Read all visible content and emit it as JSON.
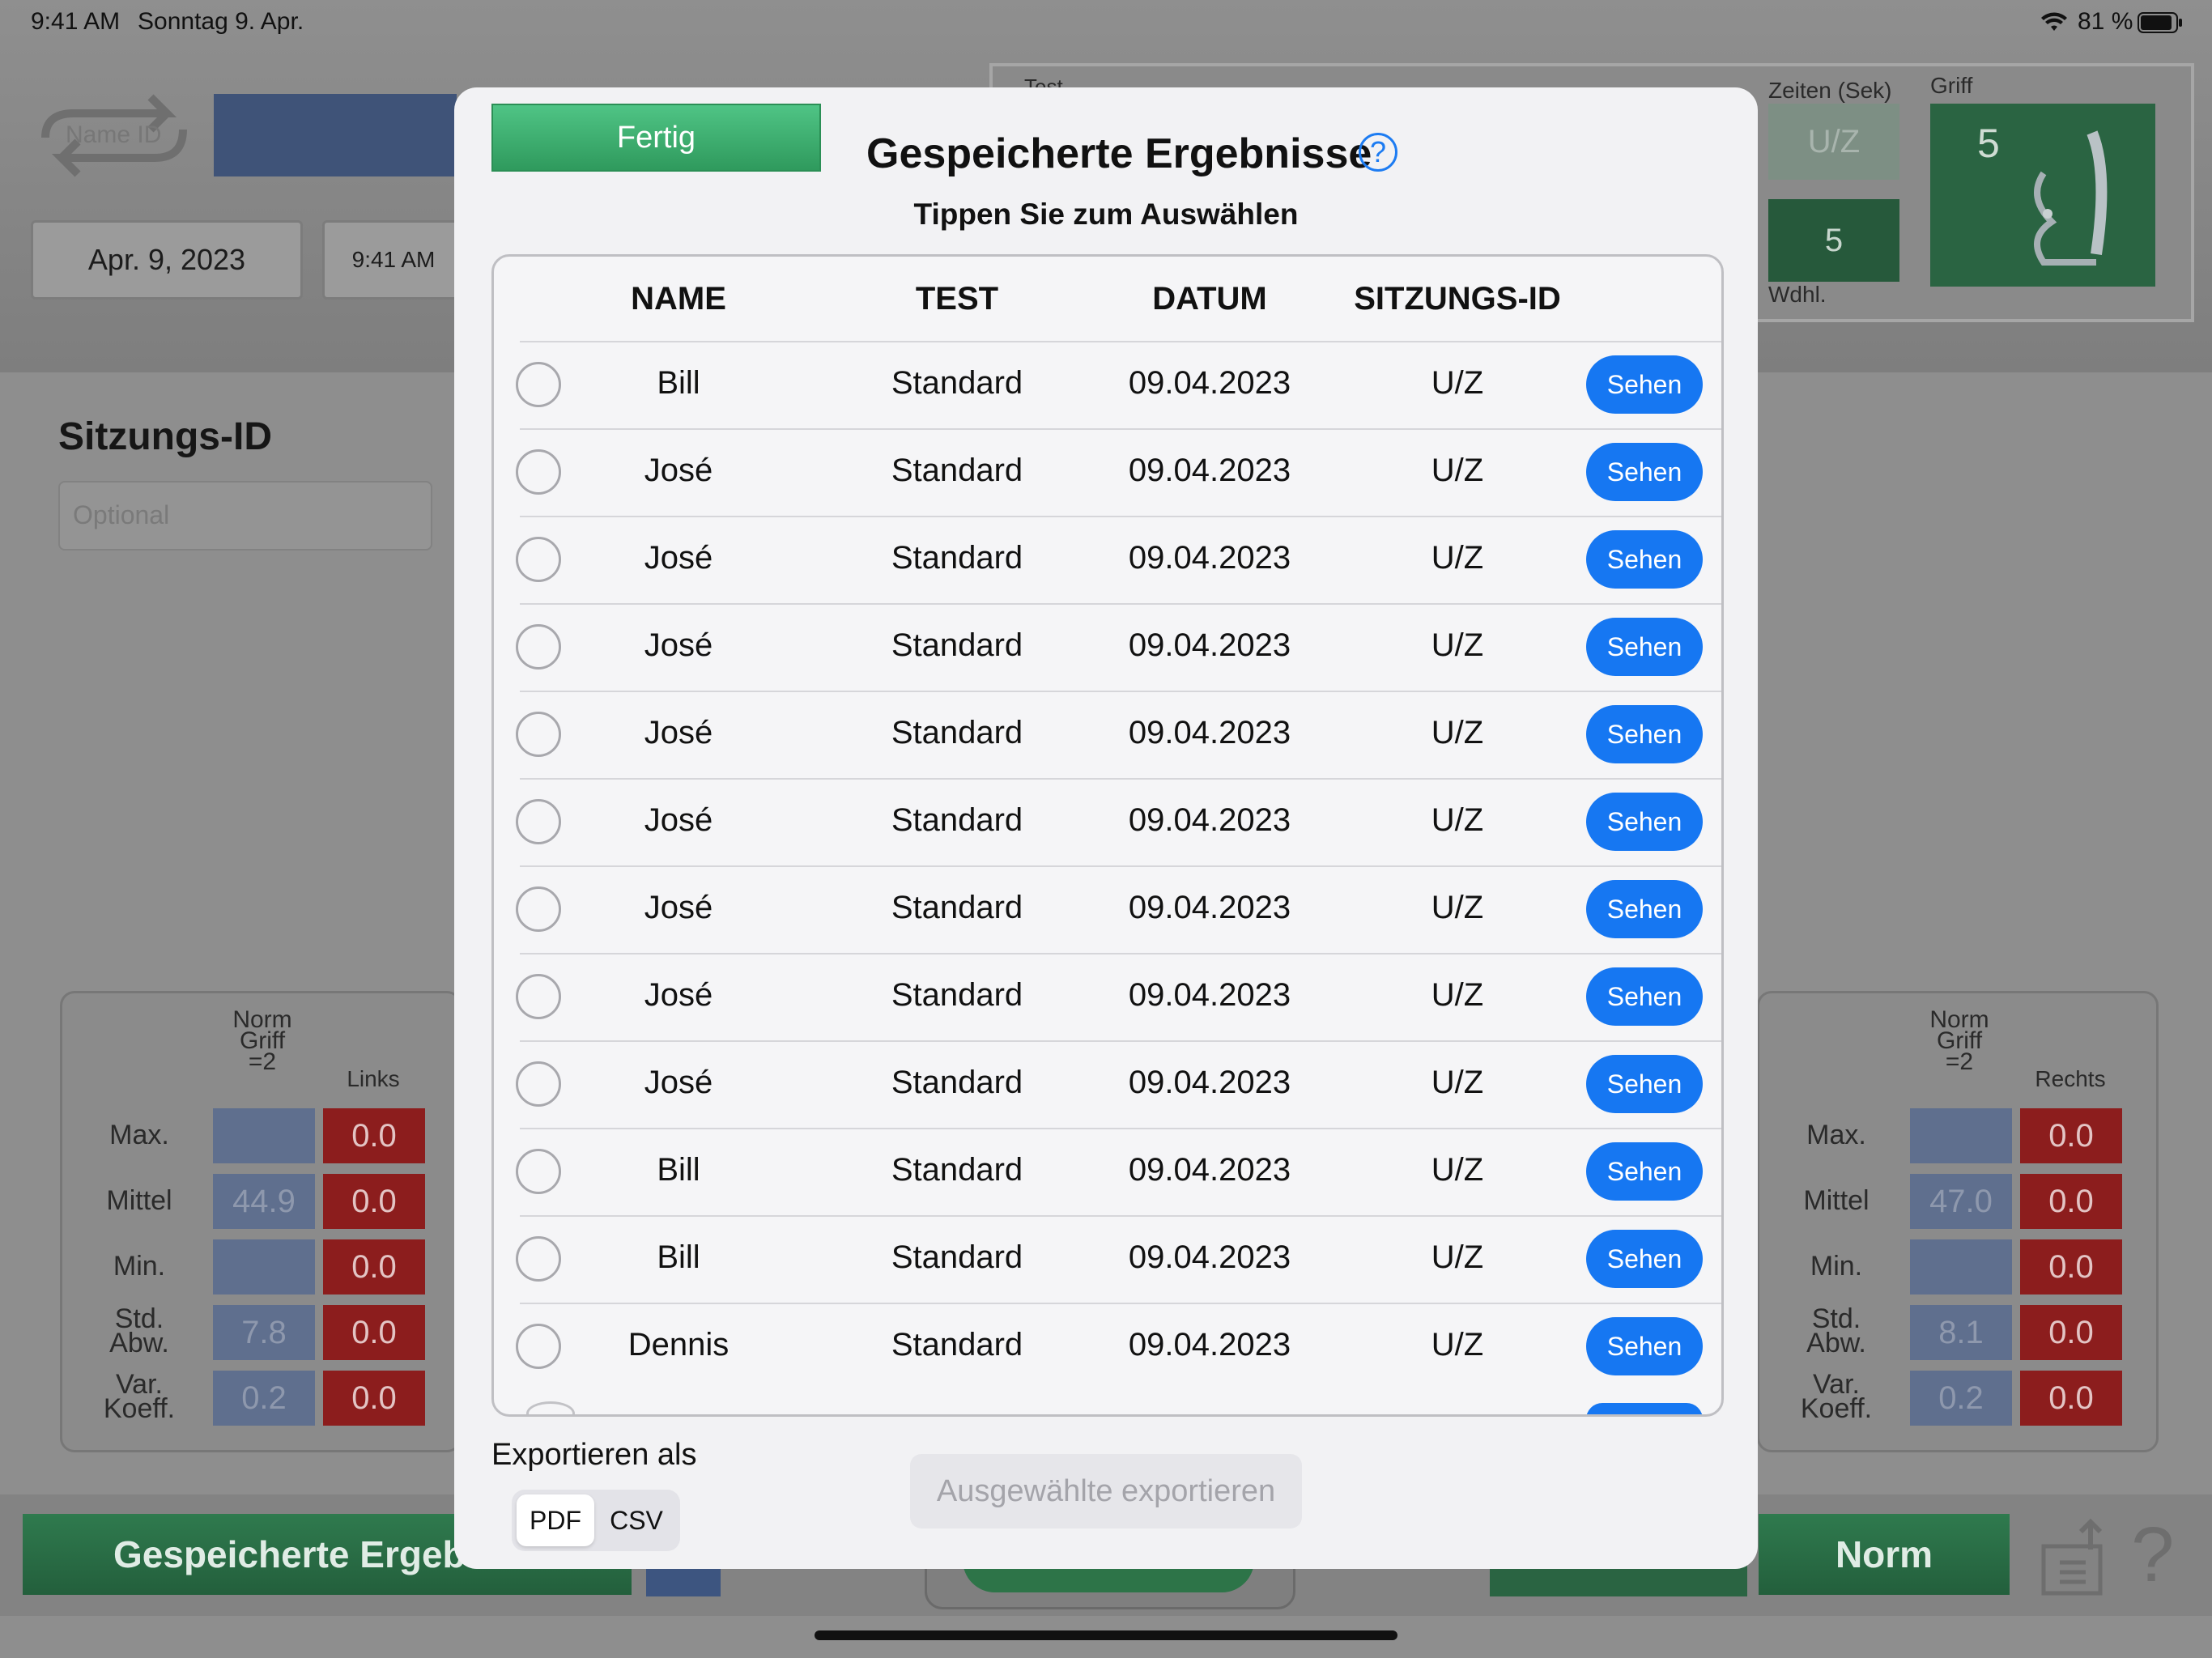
{
  "status_bar": {
    "time": "9:41 AM",
    "date": "Sonntag 9. Apr.",
    "battery": "81 %"
  },
  "background": {
    "name_id_toggle": "Name ID",
    "date_value": "Apr. 9, 2023",
    "time_value": "9:41 AM",
    "test_label": "Test",
    "session_title": "Sitzungs-ID",
    "session_placeholder": "Optional",
    "times_label": "Zeiten (Sek)",
    "times_value": "U/Z",
    "reps_value": "5",
    "reps_label": "Wdhl.",
    "grip_label": "Griff",
    "grip_value": "5",
    "left_panel": {
      "norm_header": "Norm\nGriff\n=2",
      "side_header": "Links",
      "rows": [
        {
          "label": "Max.",
          "norm": "",
          "value": "0.0"
        },
        {
          "label": "Mittel",
          "norm": "44.9",
          "value": "0.0"
        },
        {
          "label": "Min.",
          "norm": "",
          "value": "0.0"
        },
        {
          "label": "Std.\nAbw.",
          "norm": "7.8",
          "value": "0.0"
        },
        {
          "label": "Var.\nKoeff.",
          "norm": "0.2",
          "value": "0.0"
        }
      ]
    },
    "right_panel": {
      "norm_header": "Norm\nGriff\n=2",
      "side_header": "Rechts",
      "rows": [
        {
          "label": "Max.",
          "norm": "",
          "value": "0.0"
        },
        {
          "label": "Mittel",
          "norm": "47.0",
          "value": "0.0"
        },
        {
          "label": "Min.",
          "norm": "",
          "value": "0.0"
        },
        {
          "label": "Std.\nAbw.",
          "norm": "8.1",
          "value": "0.0"
        },
        {
          "label": "Var.\nKoeff.",
          "norm": "0.2",
          "value": "0.0"
        }
      ]
    },
    "saved_results_button": "Gespeicherte Ergeb",
    "norm_button": "Norm",
    "help_glyph": "?"
  },
  "modal": {
    "done_label": "Fertig",
    "title": "Gespeicherte Ergebnisse",
    "help_glyph": "?",
    "subtitle": "Tippen Sie zum Auswählen",
    "columns": [
      "NAME",
      "TEST",
      "DATUM",
      "SITZUNGS-ID"
    ],
    "view_label": "Sehen",
    "rows": [
      {
        "name": "Bill",
        "test": "Standard",
        "date": "09.04.2023",
        "session": "U/Z"
      },
      {
        "name": "José",
        "test": "Standard",
        "date": "09.04.2023",
        "session": "U/Z"
      },
      {
        "name": "José",
        "test": "Standard",
        "date": "09.04.2023",
        "session": "U/Z"
      },
      {
        "name": "José",
        "test": "Standard",
        "date": "09.04.2023",
        "session": "U/Z"
      },
      {
        "name": "José",
        "test": "Standard",
        "date": "09.04.2023",
        "session": "U/Z"
      },
      {
        "name": "José",
        "test": "Standard",
        "date": "09.04.2023",
        "session": "U/Z"
      },
      {
        "name": "José",
        "test": "Standard",
        "date": "09.04.2023",
        "session": "U/Z"
      },
      {
        "name": "José",
        "test": "Standard",
        "date": "09.04.2023",
        "session": "U/Z"
      },
      {
        "name": "José",
        "test": "Standard",
        "date": "09.04.2023",
        "session": "U/Z"
      },
      {
        "name": "Bill",
        "test": "Standard",
        "date": "09.04.2023",
        "session": "U/Z"
      },
      {
        "name": "Bill",
        "test": "Standard",
        "date": "09.04.2023",
        "session": "U/Z"
      },
      {
        "name": "Dennis",
        "test": "Standard",
        "date": "09.04.2023",
        "session": "U/Z"
      }
    ],
    "export_label": "Exportieren als",
    "format_options": [
      "PDF",
      "CSV"
    ],
    "selected_format": "PDF",
    "export_selected_label": "Ausgewählte exportieren"
  },
  "icons": {
    "wifi": "wifi-icon",
    "battery": "battery-icon",
    "help": "help-icon",
    "share": "share-icon",
    "swap": "swap-icon",
    "grip_device": "grip-dynamometer-icon"
  },
  "colors": {
    "accent_blue": "#1677f2",
    "done_green": "#3fb574",
    "stat_red": "#c0262b"
  }
}
